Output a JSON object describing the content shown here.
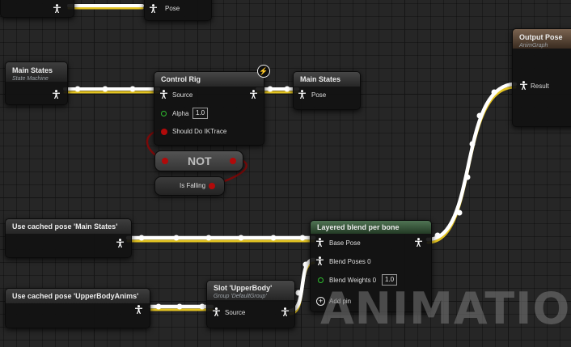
{
  "graph": {
    "top_pose_node": {
      "pin_label": "Pose"
    },
    "main_states_source": {
      "title": "Main States",
      "subtitle": "State Machine"
    },
    "control_rig": {
      "title": "Control Rig",
      "source_label": "Source",
      "alpha_label": "Alpha",
      "alpha_value": "1.0",
      "ik_label": "Should Do IKTrace",
      "badge_icon": "lightning-icon"
    },
    "main_states_cache": {
      "title": "Main States",
      "pin_label": "Pose"
    },
    "not_node": {
      "label": "NOT"
    },
    "is_falling": {
      "label": "Is Falling"
    },
    "output_pose": {
      "title": "Output Pose",
      "subtitle": "AnimGraph",
      "result_label": "Result"
    },
    "cached_main": {
      "title": "Use cached pose 'Main States'"
    },
    "layered_blend": {
      "title": "Layered blend per bone",
      "base_pose_label": "Base Pose",
      "blend_poses_label": "Blend Poses 0",
      "blend_weights_label": "Blend Weights 0",
      "blend_weights_value": "1.0",
      "add_pin_label": "Add pin"
    },
    "cached_upper": {
      "title": "Use cached pose 'UpperBodyAnims'"
    },
    "slot": {
      "title": "Slot 'UpperBody'",
      "subtitle": "Group 'DefaultGroup'",
      "source_label": "Source"
    }
  },
  "watermark": "ANIMATION",
  "colors": {
    "exec_wire": "#ffffff",
    "pose_wire_shadow": "#e3c321",
    "bool_pin": "#b10a0a",
    "float_pin": "#2fbf2f",
    "blend_header": "#4f7353",
    "output_header": "#7a6350"
  }
}
